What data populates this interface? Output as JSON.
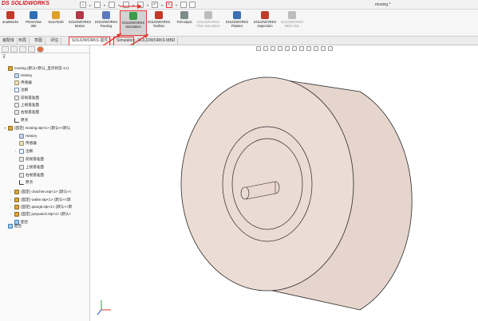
{
  "titlebar": {
    "logo_ds": "DS",
    "logo_text": "SOLIDWORKS",
    "doc_title": "mosing *"
  },
  "ribbon": {
    "commands": [
      {
        "label": "anatWorks",
        "icon": "analysis-icon",
        "color": "#c0392b",
        "dim": false,
        "highlight": false
      },
      {
        "label": "PhotoView 360",
        "icon": "photoview-icon",
        "color": "#2e6fb5",
        "dim": false,
        "highlight": false
      },
      {
        "label": "ScanTo3D",
        "icon": "scanto3d-icon",
        "color": "#e0a02c",
        "dim": false,
        "highlight": false
      },
      {
        "label": "SOLIDWORKS Motion",
        "icon": "motion-icon",
        "color": "#b23a48",
        "dim": false,
        "highlight": false
      },
      {
        "label": "SOLIDWORKS Routing",
        "icon": "routing-icon",
        "color": "#5b7bbf",
        "dim": false,
        "highlight": false
      },
      {
        "label": "SOLIDWORKS Simulation",
        "icon": "simulation-icon",
        "color": "#3a9b48",
        "dim": false,
        "highlight": true
      },
      {
        "label": "SOLIDWORKS Toolbox",
        "icon": "toolbox-icon",
        "color": "#c0392b",
        "dim": false,
        "highlight": false
      },
      {
        "label": "TolAnalyst",
        "icon": "tolanalyst-icon",
        "color": "#7f8c8d",
        "dim": false,
        "highlight": false
      },
      {
        "label": "SOLIDWORKS Flow Simulation",
        "icon": "flow-simulation-icon",
        "color": "#bdbdbd",
        "dim": true,
        "highlight": false
      },
      {
        "label": "SOLIDWORKS Plastics",
        "icon": "plastics-icon",
        "color": "#3b6fb6",
        "dim": false,
        "highlight": false
      },
      {
        "label": "SOLIDWORKS Inspection",
        "icon": "inspection-icon",
        "color": "#c23b2b",
        "dim": false,
        "highlight": false
      },
      {
        "label": "SOLIDWORKS MBD SNL",
        "icon": "mbd-snl-icon",
        "color": "#bdbdbd",
        "dim": true,
        "highlight": false
      }
    ]
  },
  "tabs": [
    {
      "label": "装配体",
      "active": false
    },
    {
      "label": "布局",
      "active": false
    },
    {
      "label": "草图",
      "active": false
    },
    {
      "label": "评估",
      "active": false
    },
    {
      "label": "SOLIDWORKS 插件",
      "active": true
    },
    {
      "label": "Simulation",
      "active": false
    },
    {
      "label": "SOLIDWORKS MBD",
      "active": false
    }
  ],
  "tree": {
    "filter_icon": "filter-icon",
    "items": [
      {
        "label": "mosing  (默认<默认_显示状态-1>)",
        "icon": "assembly-icon",
        "cls": "i-part",
        "twisty": ""
      },
      {
        "label": "History",
        "icon": "history-icon",
        "cls": "i-hist",
        "twisty": ""
      },
      {
        "label": "传感器",
        "icon": "sensor-icon",
        "cls": "i-sens",
        "twisty": ""
      },
      {
        "label": "注解",
        "icon": "annotation-icon",
        "cls": "i-note",
        "twisty": "›"
      },
      {
        "label": "前视基准面",
        "icon": "plane-icon",
        "cls": "i-plane",
        "twisty": ""
      },
      {
        "label": "上视基准面",
        "icon": "plane-icon",
        "cls": "i-plane",
        "twisty": ""
      },
      {
        "label": "右视基准面",
        "icon": "plane-icon",
        "cls": "i-plane",
        "twisty": ""
      },
      {
        "label": "原点",
        "icon": "origin-icon",
        "cls": "i-origin",
        "twisty": ""
      },
      {
        "label": "(固定) mosing.stp<1> (默认<<默认",
        "icon": "part-icon",
        "cls": "i-part",
        "twisty": "▾"
      },
      {
        "label": "History",
        "icon": "history-icon",
        "cls": "i-hist",
        "twisty": ""
      },
      {
        "label": "传感器",
        "icon": "sensor-icon",
        "cls": "i-sens",
        "twisty": ""
      },
      {
        "label": "注解",
        "icon": "annotation-icon",
        "cls": "i-note",
        "twisty": "›"
      },
      {
        "label": "前视基准面",
        "icon": "plane-icon",
        "cls": "i-plane",
        "twisty": ""
      },
      {
        "label": "上视基准面",
        "icon": "plane-icon",
        "cls": "i-plane",
        "twisty": ""
      },
      {
        "label": "右视基准面",
        "icon": "plane-icon",
        "cls": "i-plane",
        "twisty": ""
      },
      {
        "label": "原点",
        "icon": "origin-icon",
        "cls": "i-origin",
        "twisty": ""
      },
      {
        "label": "(固定) chachen.stp<1> (默认<<",
        "icon": "part-icon",
        "cls": "i-part",
        "twisty": "›"
      },
      {
        "label": "(固定) waike.stp<1> (默认<<默",
        "icon": "part-icon",
        "cls": "i-part",
        "twisty": "›"
      },
      {
        "label": "(固定) qiangti.stp<1> (默认<<默",
        "icon": "part-icon",
        "cls": "i-part",
        "twisty": "›"
      },
      {
        "label": "(固定) jueyuanzi.stp<1> (默认<",
        "icon": "part-icon",
        "cls": "i-part",
        "twisty": "›"
      },
      {
        "label": "配合",
        "icon": "mates-icon",
        "cls": "i-mate",
        "twisty": ""
      },
      {
        "label": "配合",
        "icon": "mates-icon",
        "cls": "i-mate",
        "twisty": ""
      }
    ]
  },
  "viewport": {
    "model": "mosing assembly (cylinder with shaft)",
    "body_color": "#e6d5cd",
    "edge_color": "#2a2a2a",
    "triad_icon": "coordinate-triad-icon"
  }
}
